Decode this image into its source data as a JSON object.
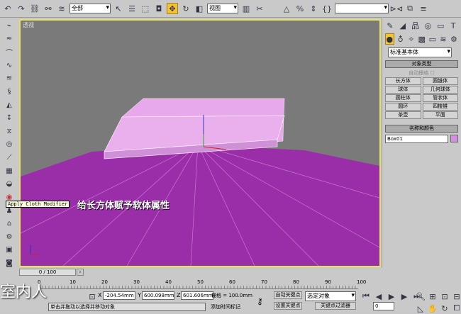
{
  "toolbar": {
    "selection_filter": "全部",
    "ref_coord": "视图",
    "named_selection": ""
  },
  "viewport": {
    "label": "透视",
    "caption": "给长方体赋予软体属性",
    "tooltip": "Apply Cloth Modifier",
    "plane_color": "#9a2ea8",
    "box_color": "#e8a8ec"
  },
  "panel": {
    "category": "标准基本体",
    "object_type_title": "对象类型",
    "autogrid": "自动栅格",
    "buttons": [
      "长方体",
      "圆锥体",
      "球体",
      "几何球体",
      "圆柱体",
      "管状体",
      "圆环",
      "四棱锥",
      "茶壶",
      "平面"
    ],
    "name_color_title": "名称和颜色",
    "object_name": "Box01",
    "object_color": "#d88ee0"
  },
  "timeline": {
    "slider": "0 / 100",
    "ticks": [
      "0",
      "10",
      "20",
      "30",
      "40",
      "50",
      "60",
      "70",
      "80",
      "90",
      "100"
    ]
  },
  "status": {
    "coords": {
      "x": "-204.54mm",
      "y": "600.098mm",
      "z": "601.606mm"
    },
    "grid": "栅格 = 100.0mm",
    "prompt": "单击并拖动以选择并移动对象",
    "add_time_tag": "添加时间标记",
    "auto_key": "自动关键点",
    "set_key": "设置关键点",
    "key_filter_select": "选定对象",
    "key_filters": "关键点过滤器",
    "frame": "0",
    "watermark": "室内人"
  }
}
